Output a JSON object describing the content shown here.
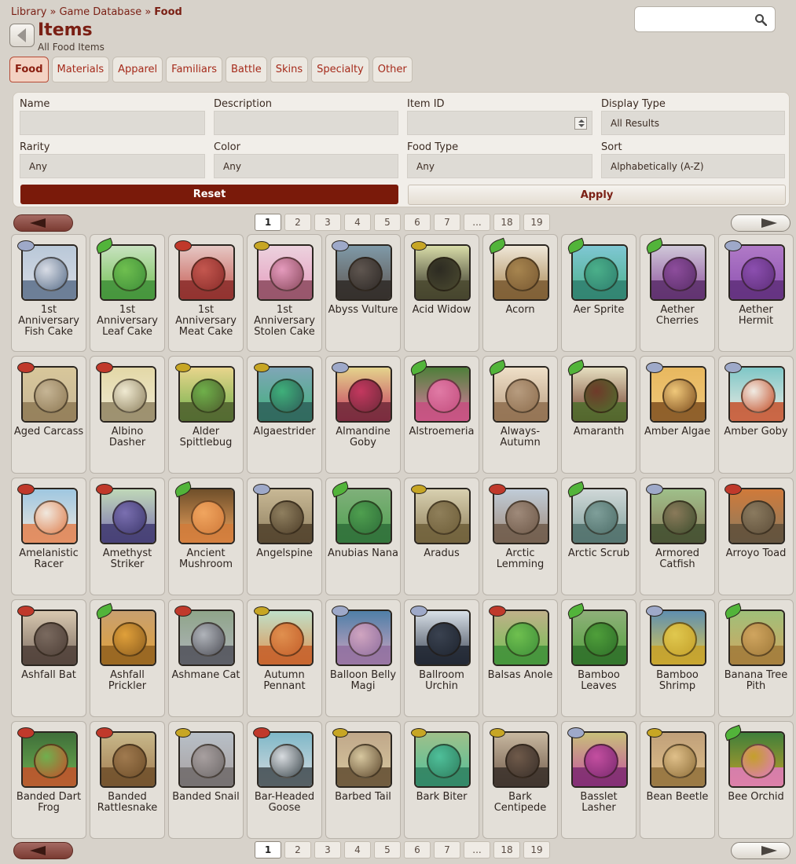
{
  "breadcrumb": [
    "Library",
    "Game Database",
    "Food"
  ],
  "breadcrumb_sep": "»",
  "header": {
    "title": "Items",
    "subtitle": "All Food Items"
  },
  "search": {
    "value": "",
    "icon": "search-icon"
  },
  "tabs": [
    {
      "label": "Food",
      "active": true
    },
    {
      "label": "Materials",
      "active": false
    },
    {
      "label": "Apparel",
      "active": false
    },
    {
      "label": "Familiars",
      "active": false
    },
    {
      "label": "Battle",
      "active": false
    },
    {
      "label": "Skins",
      "active": false
    },
    {
      "label": "Specialty",
      "active": false
    },
    {
      "label": "Other",
      "active": false
    }
  ],
  "filters": {
    "name": {
      "label": "Name",
      "value": ""
    },
    "description": {
      "label": "Description",
      "value": ""
    },
    "item_id": {
      "label": "Item ID",
      "value": ""
    },
    "display_type": {
      "label": "Display Type",
      "value": "All Results"
    },
    "rarity": {
      "label": "Rarity",
      "value": "Any"
    },
    "color": {
      "label": "Color",
      "value": "Any"
    },
    "food_type": {
      "label": "Food Type",
      "value": "Any"
    },
    "sort": {
      "label": "Sort",
      "value": "Alphabetically (A-Z)"
    },
    "reset_label": "Reset",
    "apply_label": "Apply"
  },
  "pagination": {
    "current": "1",
    "pages": [
      "1",
      "2",
      "3",
      "4",
      "5",
      "6",
      "7",
      "...",
      "18",
      "19"
    ]
  },
  "colors": {
    "accent": "#7a1f14",
    "reset_bg": "#7a1a0a",
    "meat": "#c0392b",
    "plant": "#52b43a",
    "seafood": "#9ea9c9",
    "insect": "#c7a624"
  },
  "items": [
    {
      "name": "1st Anniversary Fish Cake",
      "type": "seafood",
      "palette": [
        "#b9c8d8",
        "#5a6f8a",
        "#d9dde6"
      ]
    },
    {
      "name": "1st Anniversary Leaf Cake",
      "type": "plant",
      "palette": [
        "#c8e2c0",
        "#3f8f3a",
        "#6fbf4f"
      ]
    },
    {
      "name": "1st Anniversary Meat Cake",
      "type": "meat",
      "palette": [
        "#e6c8c4",
        "#8a2d2a",
        "#c4574f"
      ]
    },
    {
      "name": "1st Anniversary Stolen Cake",
      "type": "insect",
      "palette": [
        "#ecd2de",
        "#8b4a5e",
        "#e59bbd"
      ]
    },
    {
      "name": "Abyss Vulture",
      "type": "seafood",
      "palette": [
        "#7f9aa8",
        "#2f2a27",
        "#5f5650"
      ]
    },
    {
      "name": "Acid Widow",
      "type": "insect",
      "palette": [
        "#d8dca8",
        "#4b4a30",
        "#2d2b22"
      ]
    },
    {
      "name": "Acorn",
      "type": "plant",
      "palette": [
        "#efe7d8",
        "#7a5a33",
        "#a7854f"
      ]
    },
    {
      "name": "Aer Sprite",
      "type": "plant",
      "palette": [
        "#7fc7d3",
        "#2f7f6f",
        "#4bb08a"
      ]
    },
    {
      "name": "Aether Cherries",
      "type": "plant",
      "palette": [
        "#cfc8d8",
        "#5b2f6a",
        "#8d4d9c"
      ]
    },
    {
      "name": "Aether Hermit",
      "type": "seafood",
      "palette": [
        "#b07ac7",
        "#5f2f7a",
        "#8c4fb0"
      ]
    },
    {
      "name": "Aged Carcass",
      "type": "meat",
      "palette": [
        "#d8c79b",
        "#8f7a55",
        "#c6b595"
      ]
    },
    {
      "name": "Albino Dasher",
      "type": "meat",
      "palette": [
        "#e3d8a7",
        "#8f8260",
        "#f0ead2"
      ]
    },
    {
      "name": "Alder Spittlebug",
      "type": "insect",
      "palette": [
        "#e8d58c",
        "#4f5f2e",
        "#6fb04a"
      ]
    },
    {
      "name": "Algaestrider",
      "type": "insect",
      "palette": [
        "#7fa6b7",
        "#2f5f5a",
        "#3fb07a"
      ]
    },
    {
      "name": "Almandine Goby",
      "type": "seafood",
      "palette": [
        "#e4d38c",
        "#6f2a3a",
        "#c4385f"
      ]
    },
    {
      "name": "Alstroemeria",
      "type": "plant",
      "palette": [
        "#4f7f3a",
        "#c44f7f",
        "#e07aa5"
      ]
    },
    {
      "name": "Always-Autumn",
      "type": "plant",
      "palette": [
        "#efe0c8",
        "#8f6f4f",
        "#b79c7f"
      ]
    },
    {
      "name": "Amaranth",
      "type": "plant",
      "palette": [
        "#e6dfc0",
        "#4f6f2e",
        "#6f3a2a"
      ]
    },
    {
      "name": "Amber Algae",
      "type": "seafood",
      "palette": [
        "#e8b85f",
        "#7f4f1f",
        "#f0c87a"
      ]
    },
    {
      "name": "Amber Goby",
      "type": "seafood",
      "palette": [
        "#7fc7c7",
        "#c4502a",
        "#f0ece4"
      ]
    },
    {
      "name": "Amelanistic Racer",
      "type": "meat",
      "palette": [
        "#9fc7e0",
        "#e0804f",
        "#f0e8de"
      ]
    },
    {
      "name": "Amethyst Striker",
      "type": "meat",
      "palette": [
        "#c0d8b8",
        "#3f3a6f",
        "#7a6fb0"
      ]
    },
    {
      "name": "Ancient Mushroom",
      "type": "plant",
      "palette": [
        "#6f4f2a",
        "#d07a3a",
        "#f0a55f"
      ]
    },
    {
      "name": "Angelspine",
      "type": "seafood",
      "palette": [
        "#c8b895",
        "#4f3f2a",
        "#8f7f5f"
      ]
    },
    {
      "name": "Anubias Nana",
      "type": "plant",
      "palette": [
        "#7fb07a",
        "#2f6f3a",
        "#4f9f4f"
      ]
    },
    {
      "name": "Aradus",
      "type": "insect",
      "palette": [
        "#d8d0b0",
        "#6f5f3a",
        "#8f7f5a"
      ]
    },
    {
      "name": "Arctic Lemming",
      "type": "meat",
      "palette": [
        "#c0ccd8",
        "#6f5a4a",
        "#9f8a7a"
      ]
    },
    {
      "name": "Arctic Scrub",
      "type": "plant",
      "palette": [
        "#d0d8d8",
        "#4f6f6a",
        "#7f9f9a"
      ]
    },
    {
      "name": "Armored Catfish",
      "type": "seafood",
      "palette": [
        "#9fc08a",
        "#3f4f2f",
        "#8a7a5a"
      ]
    },
    {
      "name": "Arroyo Toad",
      "type": "meat",
      "palette": [
        "#d07a3a",
        "#5f4f3a",
        "#8a7a5f"
      ]
    },
    {
      "name": "Ashfall Bat",
      "type": "meat",
      "palette": [
        "#d8c8b0",
        "#4f4038",
        "#7a6a5f"
      ]
    },
    {
      "name": "Ashfall Prickler",
      "type": "plant",
      "palette": [
        "#c8a06f",
        "#8f5f1f",
        "#e0a03a"
      ]
    },
    {
      "name": "Ashmane Cat",
      "type": "meat",
      "palette": [
        "#8fa58a",
        "#4f5058",
        "#b0b4ba"
      ]
    },
    {
      "name": "Autumn Pennant",
      "type": "insect",
      "palette": [
        "#bfe0c8",
        "#c45f2a",
        "#e0904f"
      ]
    },
    {
      "name": "Balloon Belly Magi",
      "type": "seafood",
      "palette": [
        "#4f7fa8",
        "#8f6f9f",
        "#d0a5c0"
      ]
    },
    {
      "name": "Ballroom Urchin",
      "type": "seafood",
      "palette": [
        "#d8e0e8",
        "#1f2530",
        "#3a4250"
      ]
    },
    {
      "name": "Balsas Anole",
      "type": "meat",
      "palette": [
        "#c0b08a",
        "#3f8f3a",
        "#6fc04f"
      ]
    },
    {
      "name": "Bamboo Leaves",
      "type": "plant",
      "palette": [
        "#8fb07a",
        "#2f6f2a",
        "#4f9f3a"
      ]
    },
    {
      "name": "Bamboo Shrimp",
      "type": "seafood",
      "palette": [
        "#5f8fb0",
        "#c4a02a",
        "#e0c84f"
      ]
    },
    {
      "name": "Banana Tree Pith",
      "type": "plant",
      "palette": [
        "#a0c07a",
        "#a07a3a",
        "#d0a55f"
      ]
    },
    {
      "name": "Banded Dart Frog",
      "type": "meat",
      "palette": [
        "#3f6f3a",
        "#c4502a",
        "#6fb04f"
      ]
    },
    {
      "name": "Banded Rattlesnake",
      "type": "meat",
      "palette": [
        "#c8b88a",
        "#6f4f2a",
        "#a07a4f"
      ]
    },
    {
      "name": "Banded Snail",
      "type": "insect",
      "palette": [
        "#b8c0c8",
        "#6f6a6a",
        "#a8a0a0"
      ]
    },
    {
      "name": "Bar-Headed Goose",
      "type": "meat",
      "palette": [
        "#7fb8c8",
        "#3f4a4f",
        "#d8dce0"
      ]
    },
    {
      "name": "Barbed Tail",
      "type": "insect",
      "palette": [
        "#c0a88a",
        "#5f4a2f",
        "#d8c8a0"
      ]
    },
    {
      "name": "Bark Biter",
      "type": "insect",
      "palette": [
        "#9fc08a",
        "#2f7f5f",
        "#4fc09a"
      ]
    },
    {
      "name": "Bark Centipede",
      "type": "insect",
      "palette": [
        "#c8b8a0",
        "#3a302a",
        "#6f5a4a"
      ]
    },
    {
      "name": "Basslet Lasher",
      "type": "seafood",
      "palette": [
        "#c8c07a",
        "#7a2a6f",
        "#c44fa0"
      ]
    },
    {
      "name": "Bean Beetle",
      "type": "insect",
      "palette": [
        "#c0a07a",
        "#8f6f3a",
        "#e0c08a"
      ]
    },
    {
      "name": "Bee Orchid",
      "type": "plant",
      "palette": [
        "#3f7f3a",
        "#e07ac0",
        "#c4a02a"
      ]
    }
  ]
}
